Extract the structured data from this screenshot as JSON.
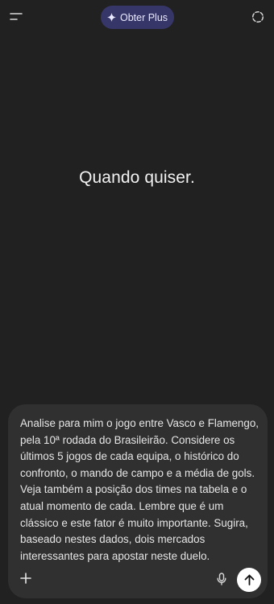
{
  "header": {
    "menu_icon": "menu-icon",
    "upgrade_label": "Obter Plus",
    "upgrade_icon": "sparkle-icon",
    "temporary_chat_icon": "dashed-circle-icon"
  },
  "main": {
    "headline": "Quando quiser."
  },
  "composer": {
    "text": "Analise para mim o jogo entre Vasco e Flamengo,\npela 10ª rodada do Brasileirão. Considere os\núltimos 5 jogos de cada equipa, o histórico do\nconfronto, o mando de campo e a média de gols.\nVeja também a posição dos times na tabela e o\natual momento de cada. Lembre que é um\nclássico e este fator é muito importante. Sugira,\nbaseado nestes dados, dois mercados\ninteressantes para apostar neste duelo.",
    "add_icon": "plus-icon",
    "mic_icon": "microphone-icon",
    "send_icon": "arrow-up-icon"
  },
  "colors": {
    "background": "#212121",
    "composer_bg": "#303030",
    "upgrade_pill_bg": "#373669",
    "send_button_bg": "#ffffff"
  }
}
